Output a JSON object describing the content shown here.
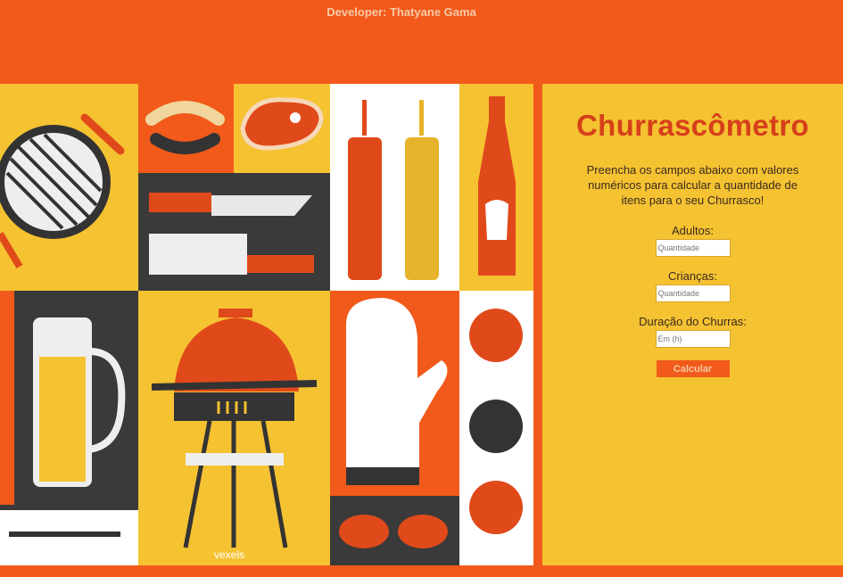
{
  "header": {
    "developer_credit": "Developer: Thatyane Gama"
  },
  "form": {
    "title": "Churrascômetro",
    "description": "Preencha os campos abaixo com valores numéricos para calcular a quantidade de itens para o seu Churrasco!",
    "adults_label": "Adultos:",
    "adults_placeholder": "Quantidade",
    "children_label": "Crianças:",
    "children_placeholder": "Quantidade",
    "duration_label": "Duração do Churras:",
    "duration_placeholder": "Em (h)",
    "calculate_label": "Calcular"
  },
  "illustration": {
    "watermark": "vexels"
  },
  "colors": {
    "orange": "#f15a1a",
    "yellow": "#f5c232",
    "dark": "#3a3a3a",
    "red": "#d6401a"
  }
}
